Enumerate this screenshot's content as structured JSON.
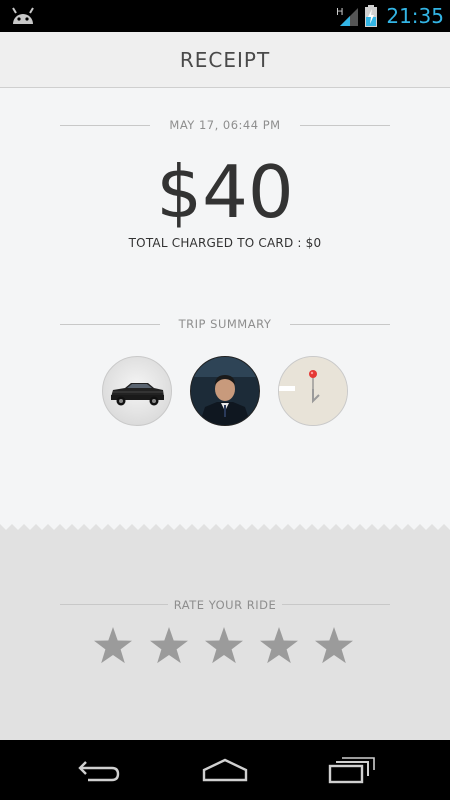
{
  "status_bar": {
    "time": "21:35",
    "network_label": "H"
  },
  "header": {
    "title": "RECEIPT"
  },
  "receipt": {
    "date": "MAY 17, 06:44 PM",
    "amount": "$40",
    "charged_text": "TOTAL CHARGED TO CARD : $0",
    "trip_summary_label": "TRIP SUMMARY"
  },
  "rating": {
    "label": "RATE YOUR RIDE",
    "max_stars": 5,
    "value": 0
  },
  "colors": {
    "status_accent": "#33b5e5",
    "star": "#9b9b9b",
    "map_pin": "#e53935"
  },
  "icons": [
    "android-icon",
    "signal-icon",
    "battery-icon",
    "back-icon",
    "home-icon",
    "recents-icon"
  ]
}
